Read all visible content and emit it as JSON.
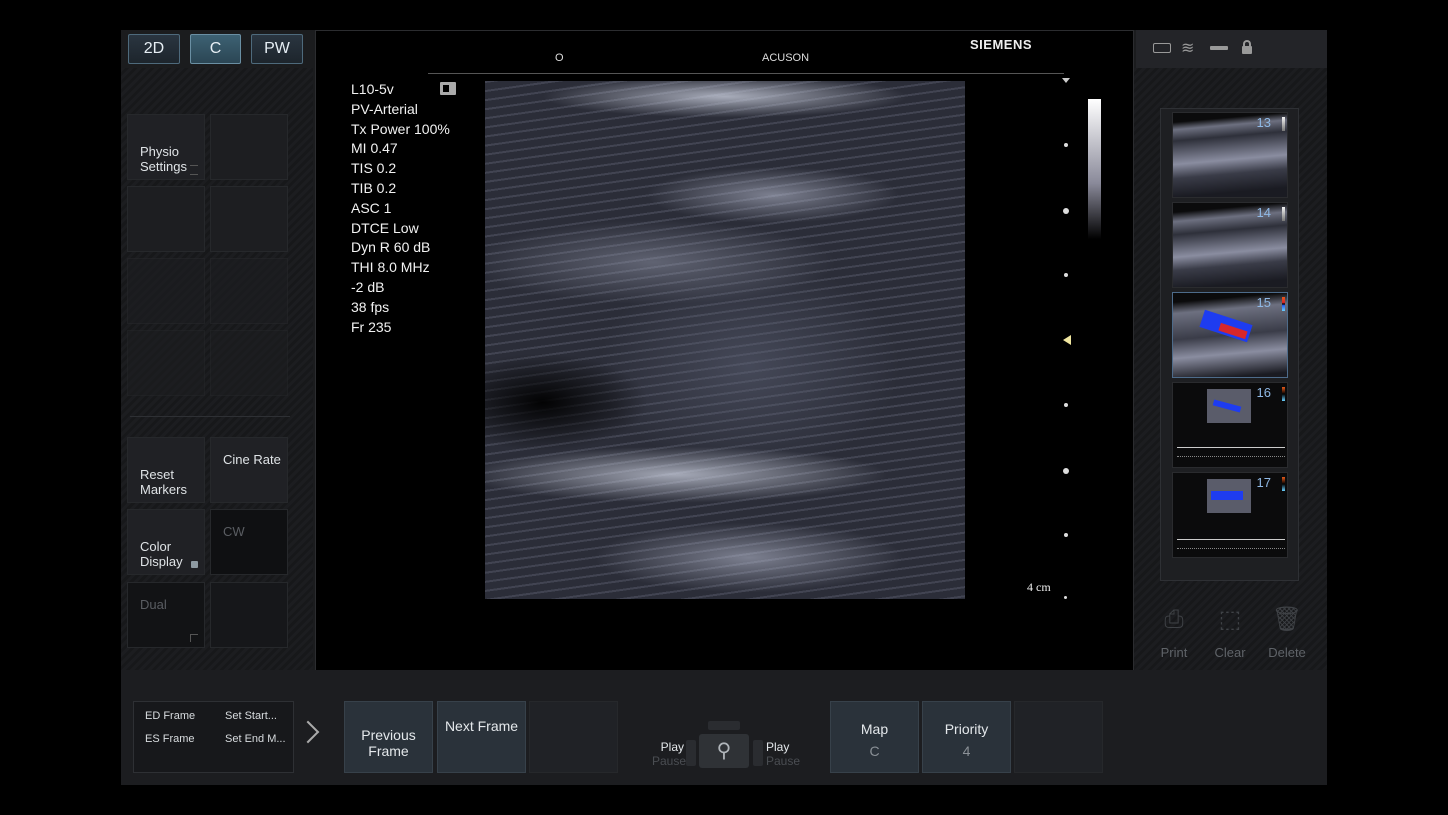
{
  "modes": [
    "2D",
    "C",
    "PW"
  ],
  "left_panel": {
    "physio_settings": "Physio\nSettings",
    "reset_markers": "Reset\nMarkers",
    "cine_rate": "Cine Rate",
    "color_display": "Color\nDisplay",
    "cw": "CW",
    "dual": "Dual"
  },
  "screen_header": {
    "marker": "O",
    "acuson": "ACUSON",
    "siemens": "SIEMENS"
  },
  "imaging_params": [
    "L10-5v",
    "PV-Arterial",
    "Tx Power 100%",
    "MI 0.47",
    "TIS 0.2",
    "TIB 0.2",
    "ASC 1",
    "DTCE Low",
    "Dyn R 60 dB",
    "THI 8.0 MHz",
    "-2 dB",
    "38 fps",
    "Fr 235"
  ],
  "depth_label": "4 cm",
  "thumbnails": [
    {
      "number": "13",
      "type": "bmode"
    },
    {
      "number": "14",
      "type": "bmode"
    },
    {
      "number": "15",
      "type": "color"
    },
    {
      "number": "16",
      "type": "doppler"
    },
    {
      "number": "17",
      "type": "doppler"
    }
  ],
  "thumb_actions": [
    "Print",
    "Clear",
    "Delete"
  ],
  "bottom": {
    "ed_frame": "ED Frame",
    "es_frame": "ES Frame",
    "set_start": "Set Start...",
    "set_end": "Set End M...",
    "previous_frame": "Previous\nFrame",
    "next_frame": "Next Frame",
    "play_left": "Play",
    "pause_left": "Pause",
    "play_right": "Play",
    "pause_right": "Pause",
    "map_label": "Map",
    "map_value": "C",
    "priority_label": "Priority",
    "priority_value": "4"
  },
  "colors": {
    "accent": "#3d6173",
    "doppler_red": "#d8262a",
    "doppler_blue": "#1e3cf0"
  },
  "icons": [
    "camera-icon",
    "wireless-icon",
    "usb-icon",
    "lock-icon",
    "print-icon",
    "clear-icon",
    "delete-icon",
    "chevron-right-icon",
    "footswitch-icon"
  ]
}
